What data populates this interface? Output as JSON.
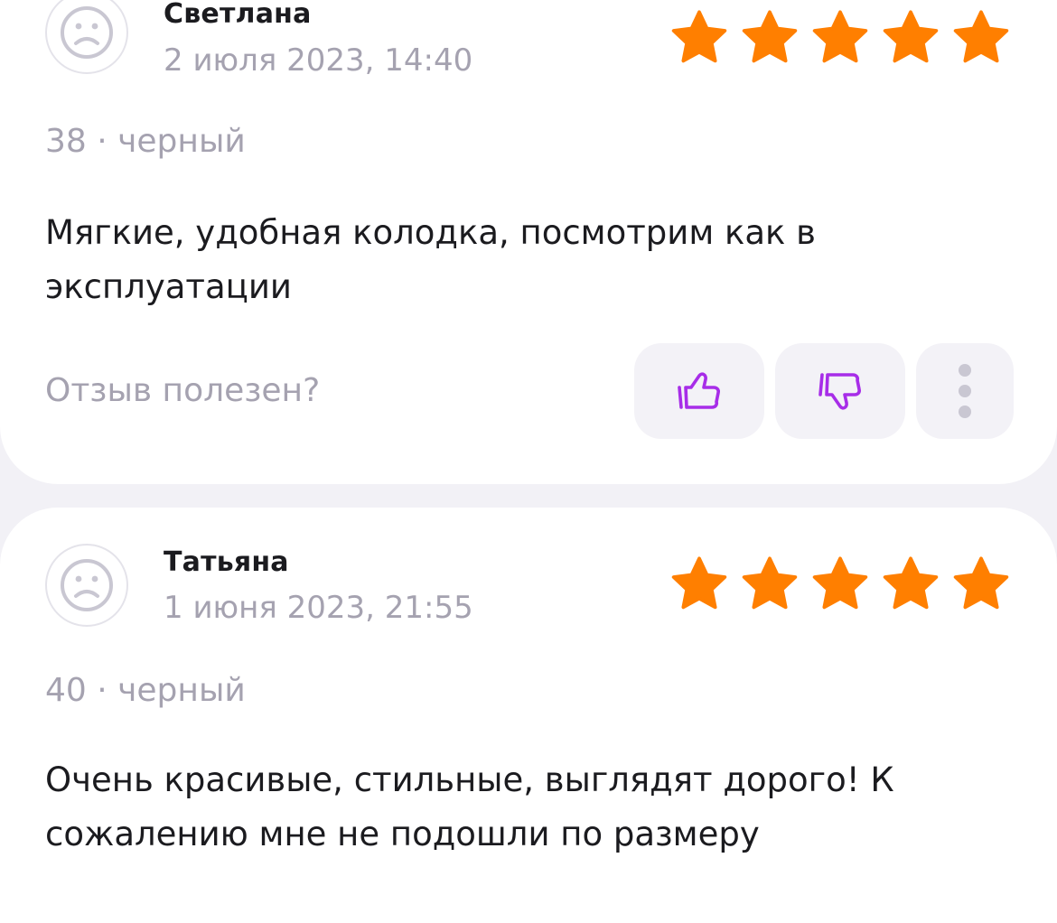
{
  "reviews": [
    {
      "author": "Светлана",
      "date": "2 июля 2023, 14:40",
      "rating": 5,
      "variant": "38 · черный",
      "text": "Мягкие, удобная колодка, посмотрим как в эксплуатации",
      "helpful_prompt": "Отзыв полезен?"
    },
    {
      "author": "Татьяна",
      "date": "1 июня 2023, 21:55",
      "rating": 5,
      "variant": "40 · черный",
      "text": "Очень красивые, стильные, выглядят дорого! К сожалению мне не подошли по размеру"
    }
  ],
  "icons": {
    "avatar": "sad-face-avatar-icon",
    "star": "star-icon",
    "like": "thumbs-up-icon",
    "dislike": "thumbs-down-icon",
    "more": "more-vertical-icon"
  },
  "colors": {
    "star": "#ff7f00",
    "accent": "#a72de8",
    "muted_text": "#a5a2b0",
    "background": "#f2f1f6"
  }
}
